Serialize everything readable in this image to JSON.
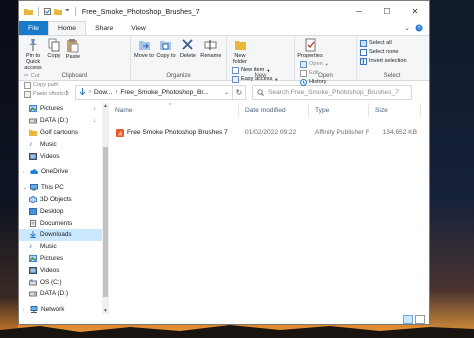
{
  "window": {
    "title": "Free_Smoke_Photoshop_Brushes_7",
    "caption": {
      "minimize": "─",
      "maximize": "☐",
      "close": "✕"
    }
  },
  "tabs": [
    {
      "label": "File"
    },
    {
      "label": "Home"
    },
    {
      "label": "Share"
    },
    {
      "label": "View"
    }
  ],
  "ribbon": {
    "clipboard": {
      "label": "Clipboard",
      "pin": "Pin to Quick access",
      "copy": "Copy",
      "paste": "Paste",
      "cut": "Cut",
      "copy_path": "Copy path",
      "paste_shortcut": "Paste shortcut"
    },
    "organize": {
      "label": "Organize",
      "move_to": "Move to",
      "copy_to": "Copy to",
      "delete": "Delete",
      "rename": "Rename"
    },
    "new": {
      "label": "New",
      "new_folder": "New folder",
      "new_item": "New item",
      "easy_access": "Easy access"
    },
    "open": {
      "label": "Open",
      "properties": "Properties",
      "open": "Open",
      "edit": "Edit",
      "history": "History"
    },
    "select": {
      "label": "Select",
      "select_all": "Select all",
      "select_none": "Select none",
      "invert": "Invert selection"
    }
  },
  "address": {
    "crumbs": [
      "Dow...",
      "Free_Smoke_Photoshop_Br..."
    ],
    "search_placeholder": "Search Free_Smoke_Photoshop_Brushes_7"
  },
  "nav": {
    "items": [
      {
        "label": "Pictures"
      },
      {
        "label": "DATA (D:)"
      },
      {
        "label": "Golf cartoons"
      },
      {
        "label": "Music"
      },
      {
        "label": "Videos"
      },
      {
        "label": "OneDrive"
      },
      {
        "label": "This PC"
      },
      {
        "label": "3D Objects"
      },
      {
        "label": "Desktop"
      },
      {
        "label": "Documents"
      },
      {
        "label": "Downloads"
      },
      {
        "label": "Music"
      },
      {
        "label": "Pictures"
      },
      {
        "label": "Videos"
      },
      {
        "label": "OS (C:)"
      },
      {
        "label": "DATA (D:)"
      },
      {
        "label": "Network"
      }
    ]
  },
  "columns": {
    "name": "Name",
    "date": "Date modified",
    "type": "Type",
    "size": "Size"
  },
  "files": [
    {
      "name": "Free Smoke Photoshop Brushes 7",
      "date": "01/02/2022 09:22",
      "type": "Affinity Publisher F...",
      "size": "134,652 KB"
    }
  ],
  "colors": {
    "accent": "#1979ca",
    "selection": "#cce8ff",
    "folder": "#e8b83a"
  }
}
